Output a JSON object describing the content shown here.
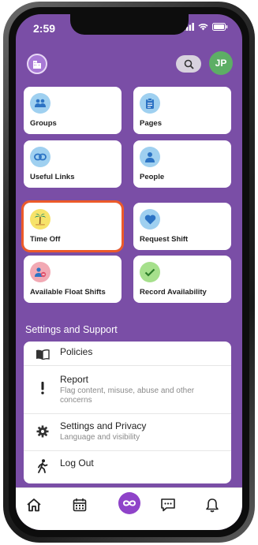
{
  "status": {
    "time": "2:59"
  },
  "header": {
    "avatar_initials": "JP"
  },
  "tiles": [
    {
      "label": "Groups",
      "icon": "groups-icon",
      "color": "#9fd0f0"
    },
    {
      "label": "Pages",
      "icon": "clipboard-icon",
      "color": "#9fd0f0"
    },
    {
      "label": "Useful Links",
      "icon": "link-icon",
      "color": "#9fd0f0"
    },
    {
      "label": "People",
      "icon": "person-icon",
      "color": "#9fd0f0"
    },
    {
      "label": "Time Off",
      "icon": "palm-tree-icon",
      "color": "#f7e36a"
    },
    {
      "label": "Request Shift",
      "icon": "heart-icon",
      "color": "#9fd0f0"
    },
    {
      "label": "Available Float Shifts",
      "icon": "float-shifts-icon",
      "color": "#f2a9b4"
    },
    {
      "label": "Record Availability",
      "icon": "check-icon",
      "color": "#a6e08c"
    }
  ],
  "settings": {
    "section_title": "Settings and Support",
    "items": [
      {
        "title": "Policies",
        "subtitle": "",
        "icon": "book-icon"
      },
      {
        "title": "Report",
        "subtitle": "Flag content, misuse, abuse and other concerns",
        "icon": "exclamation-icon"
      },
      {
        "title": "Settings and Privacy",
        "subtitle": "Language and visibility",
        "icon": "gear-icon"
      },
      {
        "title": "Log Out",
        "subtitle": "",
        "icon": "walking-person-icon"
      }
    ]
  },
  "nav": [
    "home-icon",
    "calendar-icon",
    "infinity-icon",
    "chat-icon",
    "bell-icon"
  ],
  "colors": {
    "background": "#7a4ea6",
    "highlight": "#ec5a2a",
    "accent": "#8f43c9"
  }
}
